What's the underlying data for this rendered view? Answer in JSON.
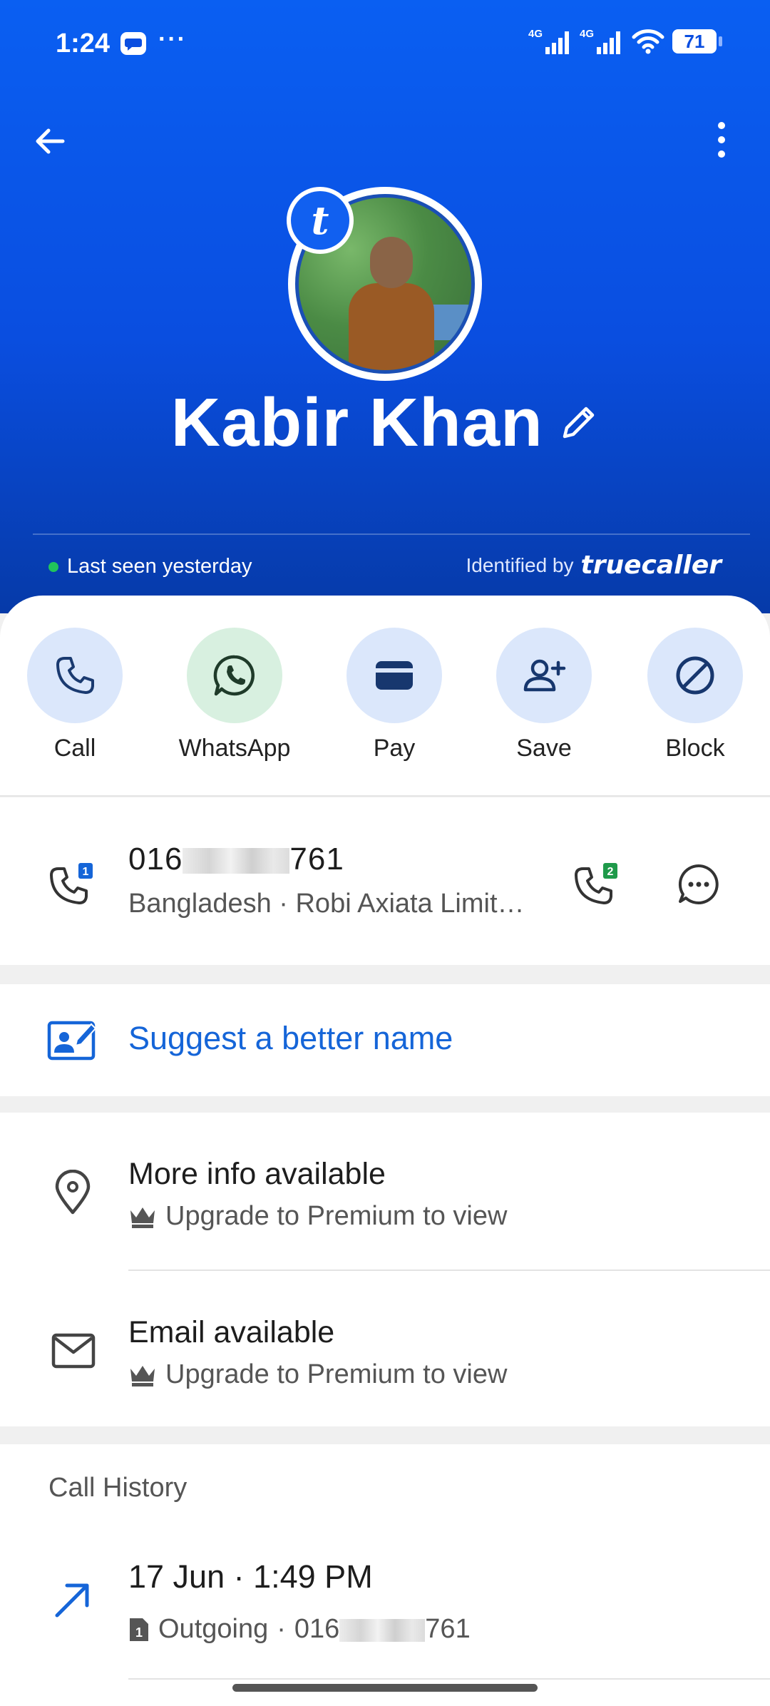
{
  "status_bar": {
    "time": "1:24",
    "dots": "···",
    "network_1": "4G",
    "network_2": "4G",
    "battery": "71"
  },
  "profile": {
    "name": "Kabir Khan",
    "last_seen": "Last seen yesterday",
    "identified_prefix": "Identified by",
    "identified_brand": "truecaller",
    "badge_letter": "t"
  },
  "actions": [
    {
      "label": "Call",
      "icon": "phone-icon"
    },
    {
      "label": "WhatsApp",
      "icon": "whatsapp-icon"
    },
    {
      "label": "Pay",
      "icon": "wallet-icon"
    },
    {
      "label": "Save",
      "icon": "add-person-icon"
    },
    {
      "label": "Block",
      "icon": "block-icon"
    }
  ],
  "phone": {
    "number_prefix": "016",
    "number_suffix": "761",
    "carrier": "Bangladesh · Robi Axiata Limit…",
    "sim1_badge": "1",
    "sim2_badge": "2"
  },
  "suggest": {
    "label": "Suggest a better name"
  },
  "info": [
    {
      "title": "More info available",
      "subtitle": "Upgrade to Premium to view",
      "icon": "location-pin-icon"
    },
    {
      "title": "Email available",
      "subtitle": "Upgrade to Premium to view",
      "icon": "mail-icon"
    }
  ],
  "call_history": {
    "title": "Call History",
    "entries": [
      {
        "time": "17 Jun · 1:49 PM",
        "direction": "Outgoing",
        "sep": "·",
        "number_prefix": "016",
        "number_suffix": "761",
        "sim": "1"
      }
    ]
  },
  "colors": {
    "header_blue": "#0a4ee0",
    "accent_blue": "#1565d8",
    "action_bg": "#dbe7fb",
    "whatsapp_bg": "#d8f0e0",
    "online_green": "#21c45c"
  }
}
